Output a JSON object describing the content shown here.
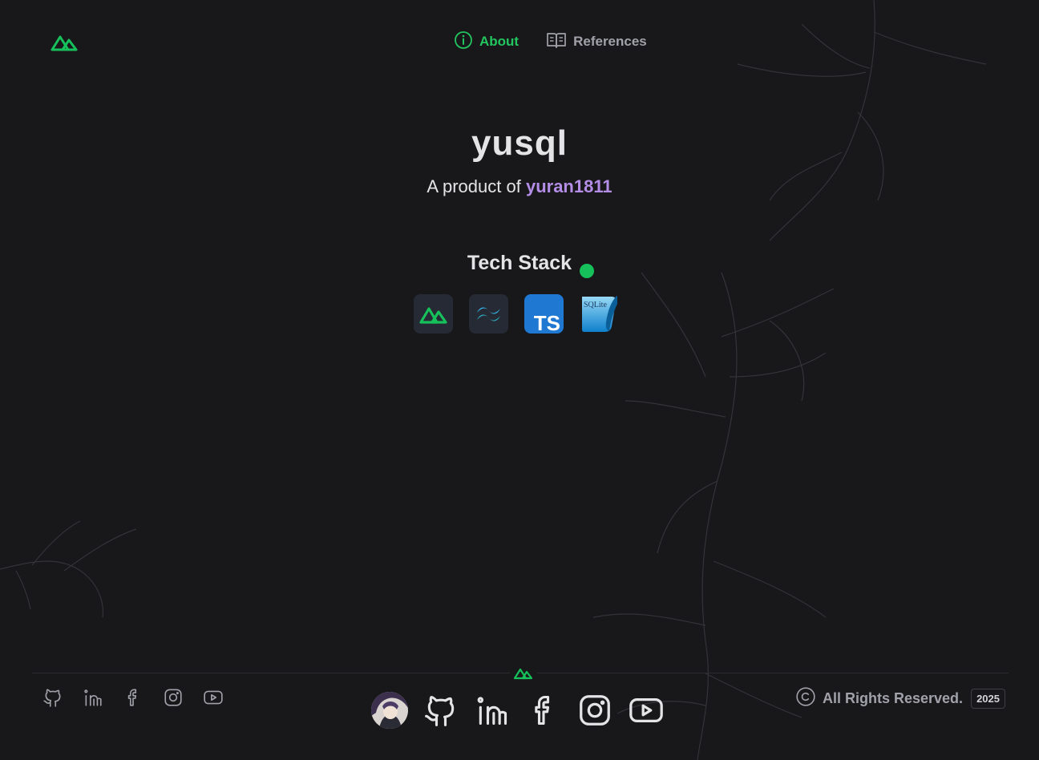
{
  "nav": {
    "items": [
      {
        "label": "About",
        "icon": "info-icon",
        "active": true
      },
      {
        "label": "References",
        "icon": "book-open-icon",
        "active": false
      }
    ]
  },
  "hero": {
    "title": "yusql",
    "subtitle_prefix": "A product of",
    "author": "yuran1811"
  },
  "tech_stack": {
    "title": "Tech Stack",
    "items": [
      {
        "name": "Nuxt",
        "icon": "nuxt-icon"
      },
      {
        "name": "Tailwind CSS",
        "icon": "tailwind-icon"
      },
      {
        "name": "TypeScript",
        "icon": "typescript-icon",
        "text": "TS"
      },
      {
        "name": "SQLite",
        "icon": "sqlite-icon",
        "text": "SQLite"
      }
    ]
  },
  "footer": {
    "social_small": [
      "github-icon",
      "linkedin-icon",
      "facebook-icon",
      "instagram-icon",
      "youtube-icon"
    ],
    "social_large": [
      "avatar",
      "github-icon",
      "linkedin-icon",
      "facebook-icon",
      "instagram-icon",
      "youtube-icon"
    ],
    "copyright": "All Rights Reserved.",
    "year": "2025"
  },
  "colors": {
    "background": "#18181b",
    "accent": "#22c55e",
    "author": "#b48ee6",
    "muted": "#a1a1aa"
  }
}
